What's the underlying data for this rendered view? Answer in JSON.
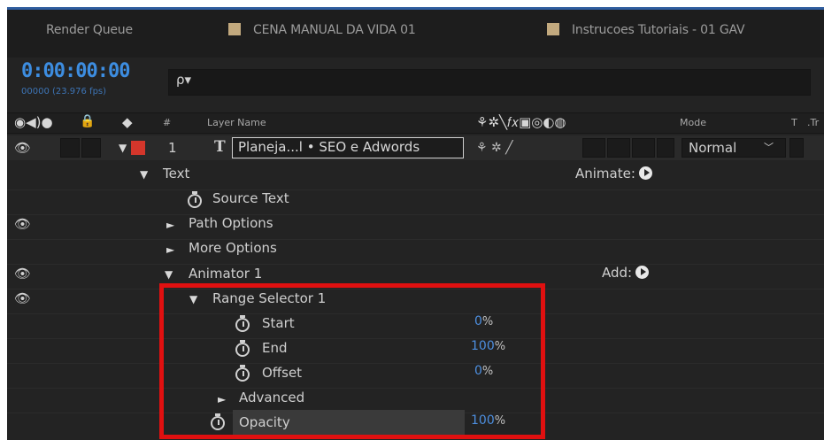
{
  "tabs": [
    {
      "label": "Render Queue",
      "swatch": false
    },
    {
      "label": "CENA MANUAL DA VIDA 01",
      "swatch": true
    },
    {
      "label": "Instrucoes Tutoriais - 01 GAV",
      "swatch": true
    }
  ],
  "time": {
    "timecode": "0:00:00:00",
    "frames": "00000 (23.976 fps)"
  },
  "search": {
    "icon": "ρ▾"
  },
  "header": {
    "num_label": "#",
    "layer_name_label": "Layer Name",
    "mode_label": "Mode",
    "t_label": "T",
    "trk_label": ".Tr"
  },
  "layer": {
    "index": "1",
    "type_glyph": "T",
    "name": "Planeja...l  • SEO e Adwords",
    "mode": "Normal",
    "label_color": "#d4362b"
  },
  "properties": {
    "text": "Text",
    "animate_label": "Animate:",
    "source_text": "Source Text",
    "path_options": "Path Options",
    "more_options": "More Options",
    "animator": "Animator 1",
    "add_label": "Add:",
    "range_selector": "Range Selector 1",
    "start": {
      "label": "Start",
      "value": "0",
      "unit": "%"
    },
    "end": {
      "label": "End",
      "value": "100",
      "unit": "%"
    },
    "offset": {
      "label": "Offset",
      "value": "0",
      "unit": "%"
    },
    "advanced": "Advanced",
    "opacity": {
      "label": "Opacity",
      "value": "100",
      "unit": "%"
    }
  },
  "colors": {
    "timecode": "#3d8de0",
    "value_blue": "#4d8fe0",
    "highlight_red": "#e01010",
    "tab_swatch": "#c2a97e"
  }
}
